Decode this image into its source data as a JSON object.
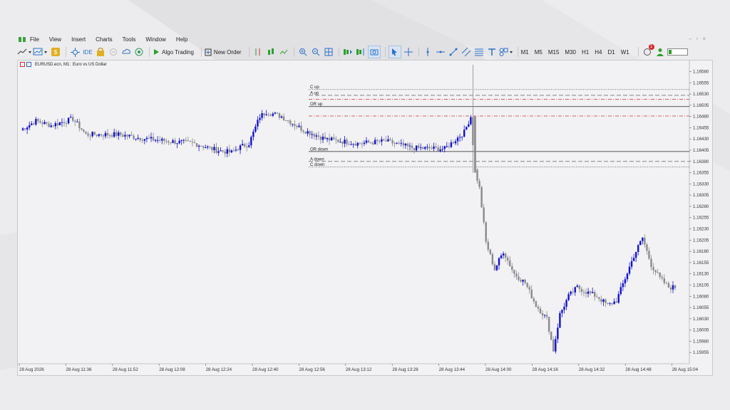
{
  "menu": {
    "items": [
      "File",
      "View",
      "Insert",
      "Charts",
      "Tools",
      "Window",
      "Help"
    ]
  },
  "toolbar": {
    "ide_label": "IDE",
    "algo_trading_label": "Algo Trading",
    "new_order_label": "New Order",
    "timeframes": [
      "M1",
      "M5",
      "M15",
      "M30",
      "H1",
      "H4",
      "D1",
      "W1"
    ],
    "alerts_badge": "1"
  },
  "chart_header": {
    "symbol": "EURUSD.ecn, M1:",
    "description": "Euro vs US Dollar"
  },
  "colors": {
    "bull": "#1010d0",
    "bear": "#8a8a8a",
    "line_solid": "#222222",
    "line_red": "#c83232"
  },
  "chart_data": {
    "type": "candlestick",
    "symbol": "EURUSD.ecn",
    "timeframe": "M1",
    "ylim": [
      1.1593,
      1.16595
    ],
    "y_ticks": [
      "1.16580",
      "1.16555",
      "1.16530",
      "1.16505",
      "1.16480",
      "1.16455",
      "1.16430",
      "1.16405",
      "1.16380",
      "1.16355",
      "1.16330",
      "1.16305",
      "1.16280",
      "1.16255",
      "1.16230",
      "1.16205",
      "1.16180",
      "1.16155",
      "1.16130",
      "1.16105",
      "1.16080",
      "1.16055",
      "1.16030",
      "1.16005",
      "1.15980",
      "1.15955"
    ],
    "x_ticks": [
      "28 Aug 2026",
      "28 Aug 11:36",
      "28 Aug 11:52",
      "28 Aug 12:08",
      "28 Aug 12:24",
      "28 Aug 12:40",
      "28 Aug 12:56",
      "28 Aug 13:12",
      "28 Aug 13:28",
      "28 Aug 13:44",
      "28 Aug 14:00",
      "28 Aug 14:16",
      "28 Aug 14:32",
      "28 Aug 14:48",
      "28 Aug 15:04"
    ],
    "levels": [
      {
        "label": "C up",
        "price": 1.1654,
        "style": "dotted",
        "color": "#444444"
      },
      {
        "label": "A up",
        "price": 1.16527,
        "style": "dashed",
        "color": "#444444"
      },
      {
        "label": "",
        "price": 1.16518,
        "style": "dashdot",
        "color": "#c83232"
      },
      {
        "label": "OR up",
        "price": 1.16502,
        "style": "solid",
        "color": "#222222"
      },
      {
        "label": "",
        "price": 1.16481,
        "style": "dashdot",
        "color": "#c83232"
      },
      {
        "label": "OR down",
        "price": 1.16402,
        "style": "solid",
        "color": "#222222"
      },
      {
        "label": "A down",
        "price": 1.1638,
        "style": "dashed",
        "color": "#444444"
      },
      {
        "label": "C down",
        "price": 1.16368,
        "style": "dotted",
        "color": "#444444"
      }
    ],
    "anchors": [
      [
        0,
        1.1645
      ],
      [
        7,
        1.1647
      ],
      [
        14,
        1.1646
      ],
      [
        24,
        1.16475
      ],
      [
        30,
        1.1644
      ],
      [
        45,
        1.1644
      ],
      [
        58,
        1.1643
      ],
      [
        68,
        1.16425
      ],
      [
        80,
        1.1642
      ],
      [
        90,
        1.16405
      ],
      [
        97,
        1.164
      ],
      [
        100,
        1.1641
      ],
      [
        105,
        1.1642
      ],
      [
        110,
        1.1648
      ],
      [
        113,
        1.1649
      ],
      [
        120,
        1.1648
      ],
      [
        130,
        1.1645
      ],
      [
        140,
        1.1643
      ],
      [
        155,
        1.1642
      ],
      [
        168,
        1.16425
      ],
      [
        180,
        1.1641
      ],
      [
        195,
        1.16408
      ],
      [
        204,
        1.16445
      ],
      [
        207,
        1.1648
      ],
      [
        209,
        1.1636
      ],
      [
        211,
        1.1632
      ],
      [
        214,
        1.162
      ],
      [
        218,
        1.1614
      ],
      [
        222,
        1.1618
      ],
      [
        227,
        1.1613
      ],
      [
        232,
        1.1611
      ],
      [
        237,
        1.1606
      ],
      [
        242,
        1.1603
      ],
      [
        245,
        1.1596
      ],
      [
        248,
        1.1604
      ],
      [
        252,
        1.1608
      ],
      [
        256,
        1.161
      ],
      [
        260,
        1.1609
      ],
      [
        265,
        1.1608
      ],
      [
        270,
        1.1606
      ],
      [
        274,
        1.1607
      ],
      [
        278,
        1.1612
      ],
      [
        282,
        1.1617
      ],
      [
        286,
        1.1621
      ],
      [
        290,
        1.1615
      ],
      [
        294,
        1.1612
      ],
      [
        298,
        1.161
      ],
      [
        301,
        1.161
      ]
    ],
    "spike": {
      "index": 208,
      "high": 1.16595,
      "low": 1.16355
    }
  }
}
